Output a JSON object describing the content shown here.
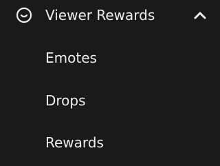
{
  "section": {
    "label": "Viewer Rewards",
    "icon": "smiley-face-icon",
    "toggle_icon": "chevron-up-icon",
    "expanded": true
  },
  "items": [
    {
      "label": "Emotes"
    },
    {
      "label": "Drops"
    },
    {
      "label": "Rewards"
    }
  ],
  "colors": {
    "background": "#1a1a1a",
    "text": "#efeff1"
  }
}
